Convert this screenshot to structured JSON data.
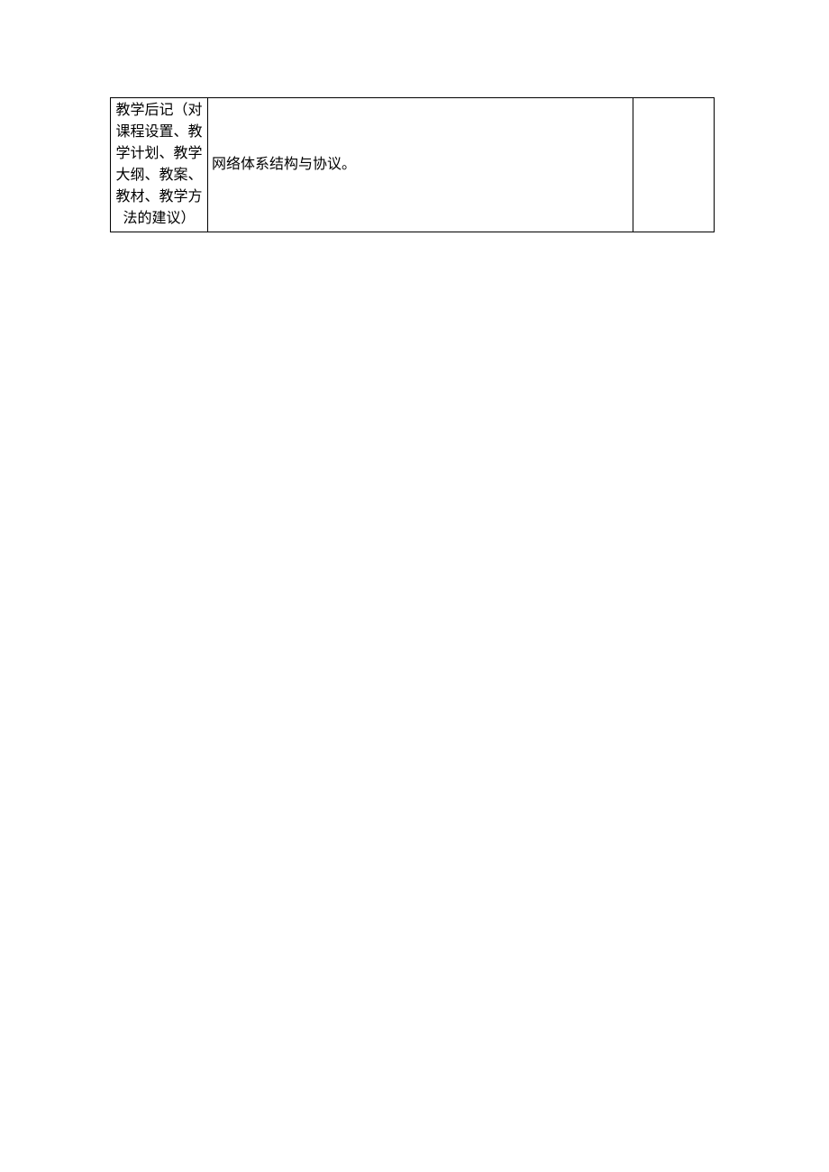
{
  "table": {
    "row": {
      "label": "教学后记（对课程设置、教学计划、教学大纲、教案、教材、教学方法的建议）",
      "content": "网络体系结构与协议。"
    }
  }
}
